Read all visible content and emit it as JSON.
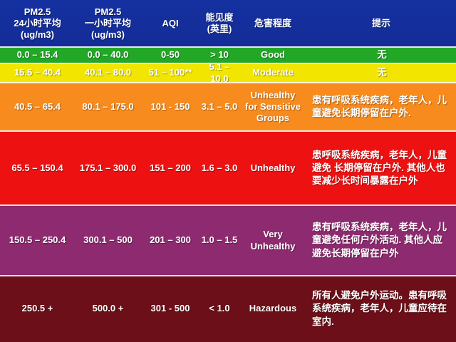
{
  "header": {
    "col1": "PM2.5\n24小时平均\n(ug/m3)",
    "col2": "PM2.5\n一小时平均\n(ug/m3)",
    "col3": "AQI",
    "col4": "能见度\n(英里)",
    "col5": "危害程度",
    "col6": "提示"
  },
  "rows": [
    {
      "pm24": "0.0 – 15.4",
      "pm1": "0.0 – 40.0",
      "aqi": "0-50",
      "vis": "> 10",
      "level": "Good",
      "tip": "无",
      "color": "#22a826"
    },
    {
      "pm24": "15.5 – 40.4",
      "pm1": "40.1 – 80.0",
      "aqi": "51 – 100**",
      "vis": "5.1 – 10.0",
      "level": "Moderate",
      "tip": "无",
      "color": "#f2e600"
    },
    {
      "pm24": "40.5 – 65.4",
      "pm1": "80.1 – 175.0",
      "aqi": "101 - 150",
      "vis": "3.1 – 5.0",
      "level": "Unhealthy\nfor Sensitive\nGroups",
      "tip": "患有呼吸系统疾病，老年人，儿童避免长期停留在户外.",
      "color": "#f78b1e"
    },
    {
      "pm24": "65.5 – 150.4",
      "pm1": "175.1 – 300.0",
      "aqi": "151 – 200",
      "vis": "1.6 – 3.0",
      "level": "Unhealthy",
      "tip": "患呼吸系统疾病，老年人，儿童避免 长期停留在户外. 其他人也要减少长时间暴露在户外",
      "color": "#ee1111"
    },
    {
      "pm24": "150.5 – 250.4",
      "pm1": "300.1 – 500",
      "aqi": "201 – 300",
      "vis": "1.0 – 1.5",
      "level": "Very\nUnhealthy",
      "tip": "患有呼吸系统疾病，老年人，儿童避免任何户外活动. 其他人应避免长期停留在户外",
      "color": "#8e2a6f"
    },
    {
      "pm24": "250.5 +",
      "pm1": "500.0 +",
      "aqi": "301 - 500",
      "vis": "< 1.0",
      "level": "Hazardous",
      "tip": "所有人避免户外运动。患有呼吸系统疾病，老年人，儿童应待在室内.",
      "color": "#6d0f18"
    }
  ]
}
